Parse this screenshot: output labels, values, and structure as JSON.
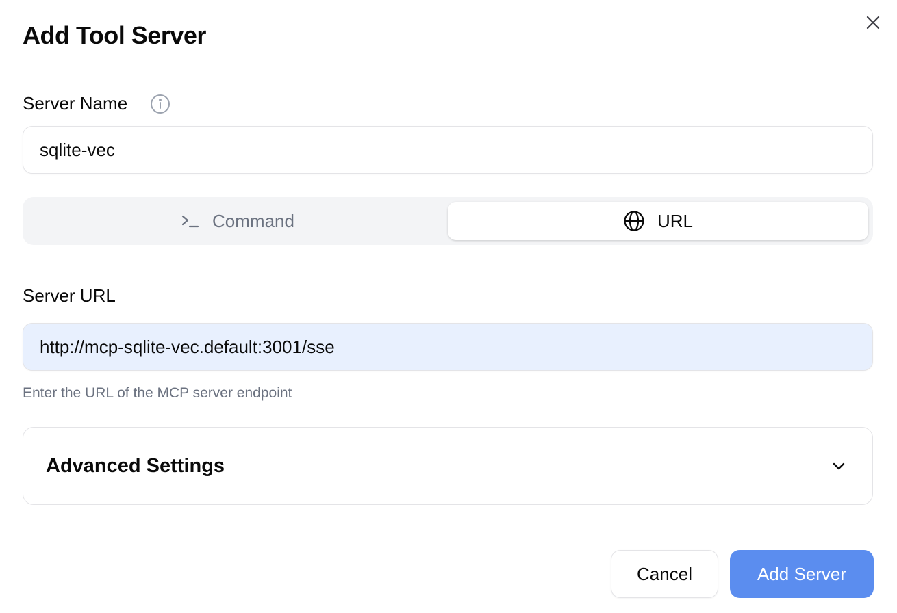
{
  "dialog": {
    "title": "Add Tool Server",
    "close_icon": "close-icon"
  },
  "server_name": {
    "label": "Server Name",
    "info_icon": "info-icon",
    "value": "sqlite-vec"
  },
  "mode_tabs": {
    "items": [
      {
        "label": "Command",
        "icon": "terminal-icon",
        "selected": false
      },
      {
        "label": "URL",
        "icon": "globe-icon",
        "selected": true
      }
    ]
  },
  "server_url": {
    "label": "Server URL",
    "value": "http://mcp-sqlite-vec.default:3001/sse",
    "helper_text": "Enter the URL of the MCP server endpoint"
  },
  "advanced_settings": {
    "label": "Advanced Settings",
    "expanded": false,
    "icon": "chevron-down-icon"
  },
  "footer": {
    "cancel_label": "Cancel",
    "submit_label": "Add Server"
  },
  "colors": {
    "primary": "#5b8def",
    "url_input_bg": "#e8f0fe",
    "tabs_bg": "#f3f4f6",
    "muted_text": "#6b7280",
    "border": "#e4e4e7"
  }
}
